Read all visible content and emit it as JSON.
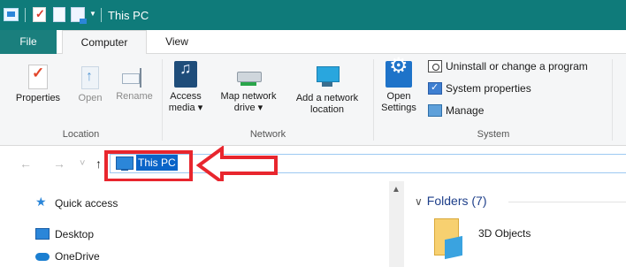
{
  "titlebar": {
    "title": "This PC"
  },
  "tabs": [
    {
      "label": "File"
    },
    {
      "label": "Computer"
    },
    {
      "label": "View"
    }
  ],
  "ribbon": {
    "location": {
      "label": "Location",
      "buttons": [
        {
          "label": "Properties",
          "icon": "properties-icon",
          "enabled": true
        },
        {
          "label": "Open",
          "icon": "open-icon",
          "enabled": false
        },
        {
          "label": "Rename",
          "icon": "rename-icon",
          "enabled": false
        }
      ]
    },
    "network": {
      "label": "Network",
      "buttons": [
        {
          "line1": "Access",
          "line2": "media ▾",
          "icon": "access-media-icon"
        },
        {
          "line1": "Map network",
          "line2": "drive ▾",
          "icon": "map-network-drive-icon"
        },
        {
          "line1": "Add a network",
          "line2": "location",
          "icon": "network-location-icon"
        }
      ]
    },
    "system": {
      "label": "System",
      "open_settings": {
        "line1": "Open",
        "line2": "Settings",
        "icon": "settings-gear-icon"
      },
      "items": [
        {
          "label": "Uninstall or change a program",
          "icon": "uninstall-icon"
        },
        {
          "label": "System properties",
          "icon": "system-properties-icon"
        },
        {
          "label": "Manage",
          "icon": "manage-icon"
        }
      ]
    }
  },
  "addressbar": {
    "back": "←",
    "forward": "→",
    "recent": "˅",
    "up": "↑",
    "path": "This PC",
    "annotation_color": "#e8262e"
  },
  "navpane": {
    "items": [
      {
        "label": "Quick access",
        "icon": "star-icon"
      },
      {
        "label": "Desktop",
        "icon": "desktop-icon"
      },
      {
        "label": "OneDrive",
        "icon": "cloud-icon"
      }
    ]
  },
  "content": {
    "group_header": "Folders (7)",
    "chevron": "∨",
    "items": [
      {
        "label": "3D Objects",
        "icon": "3d-objects-folder-icon"
      }
    ]
  },
  "colors": {
    "titlebar": "#0f7b7a",
    "file_tab": "#1a7f7d",
    "selection": "#0a64c8",
    "ribbon_bg": "#f5f6f7"
  }
}
